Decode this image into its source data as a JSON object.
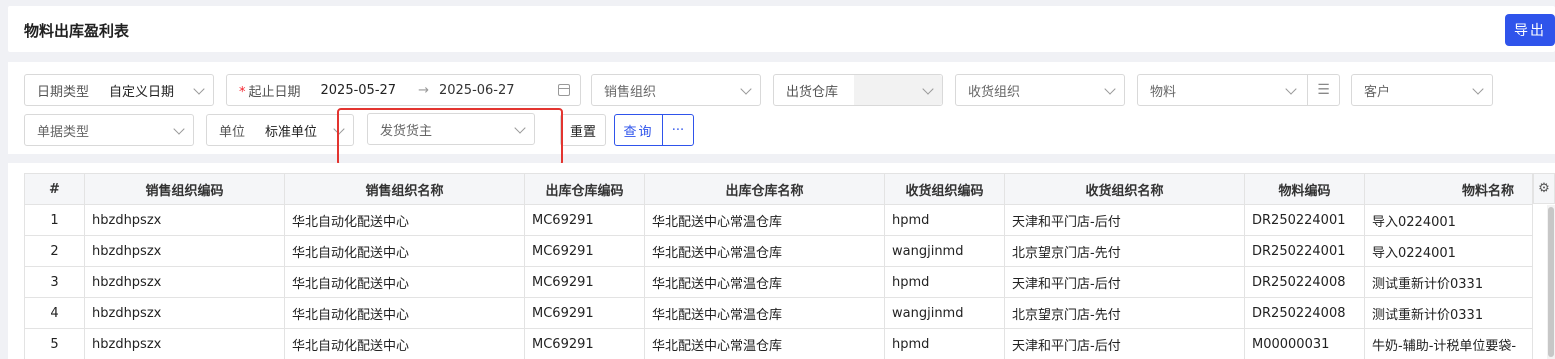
{
  "header": {
    "title": "物料出库盈利表",
    "export_label": "导出"
  },
  "filters": {
    "date_type": {
      "label": "日期类型",
      "value": "自定义日期"
    },
    "date_range": {
      "required_mark": "*",
      "label": "起止日期",
      "start": "2025-05-27",
      "arrow": "→",
      "end": "2025-06-27"
    },
    "sales_org": {
      "placeholder": "销售组织"
    },
    "ship_warehouse": {
      "label": "出货仓库"
    },
    "receive_org": {
      "placeholder": "收货组织"
    },
    "material": {
      "placeholder": "物料"
    },
    "customer": {
      "placeholder": "客户"
    },
    "doc_type": {
      "placeholder": "单据类型"
    },
    "unit": {
      "label": "单位",
      "value": "标准单位"
    },
    "ship_owner": {
      "placeholder": "发货货主"
    },
    "reset_label": "重置",
    "query_label": "查询",
    "more_label": "···"
  },
  "table": {
    "columns": [
      "#",
      "销售组织编码",
      "销售组织名称",
      "出库仓库编码",
      "出库仓库名称",
      "收货组织编码",
      "收货组织名称",
      "物料编码",
      "物料名称"
    ],
    "rows": [
      [
        "1",
        "hbzdhpszx",
        "华北自动化配送中心",
        "MC69291",
        "华北配送中心常温仓库",
        "hpmd",
        "天津和平门店-后付",
        "DR250224001",
        "导入0224001"
      ],
      [
        "2",
        "hbzdhpszx",
        "华北自动化配送中心",
        "MC69291",
        "华北配送中心常温仓库",
        "wangjinmd",
        "北京望京门店-先付",
        "DR250224001",
        "导入0224001"
      ],
      [
        "3",
        "hbzdhpszx",
        "华北自动化配送中心",
        "MC69291",
        "华北配送中心常温仓库",
        "hpmd",
        "天津和平门店-后付",
        "DR250224008",
        "测试重新计价0331"
      ],
      [
        "4",
        "hbzdhpszx",
        "华北自动化配送中心",
        "MC69291",
        "华北配送中心常温仓库",
        "wangjinmd",
        "北京望京门店-先付",
        "DR250224008",
        "测试重新计价0331"
      ],
      [
        "5",
        "hbzdhpszx",
        "华北自动化配送中心",
        "MC69291",
        "华北配送中心常温仓库",
        "hpmd",
        "天津和平门店-后付",
        "M00000031",
        "牛奶-辅助-计税单位要袋-"
      ]
    ]
  },
  "colors": {
    "primary": "#2f54eb",
    "highlight": "#e3342f"
  }
}
